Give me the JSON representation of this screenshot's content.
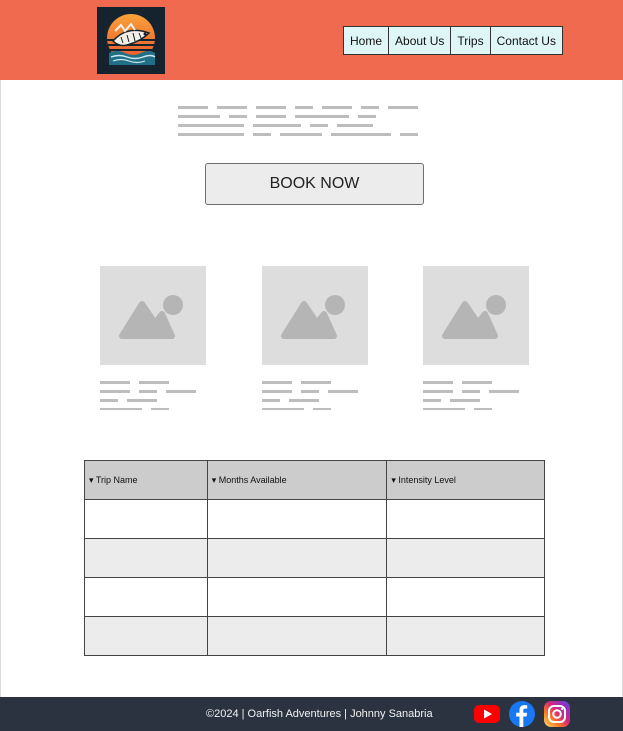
{
  "nav": {
    "items": [
      "Home",
      "About Us",
      "Trips",
      "Contact Us"
    ]
  },
  "book_button": {
    "label": "BOOK NOW"
  },
  "table": {
    "headers": [
      "▾ Trip Name",
      "▾ Months Available",
      "▾ Intensity Level"
    ],
    "rows": [
      [
        "",
        "",
        ""
      ],
      [
        "",
        "",
        ""
      ],
      [
        "",
        "",
        ""
      ],
      [
        "",
        "",
        ""
      ]
    ]
  },
  "footer": {
    "text": "©2024 | Oarfish Adventures | Johnny Sanabria"
  },
  "icons": {
    "logo": "oarfish-logo",
    "social": [
      "youtube-icon",
      "facebook-icon",
      "instagram-icon"
    ]
  },
  "colors": {
    "header": "#ef6a4e",
    "nav_bg": "#dff6f6",
    "footer": "#2b3341",
    "youtube": "#ff0000",
    "facebook": "#1877f2"
  }
}
